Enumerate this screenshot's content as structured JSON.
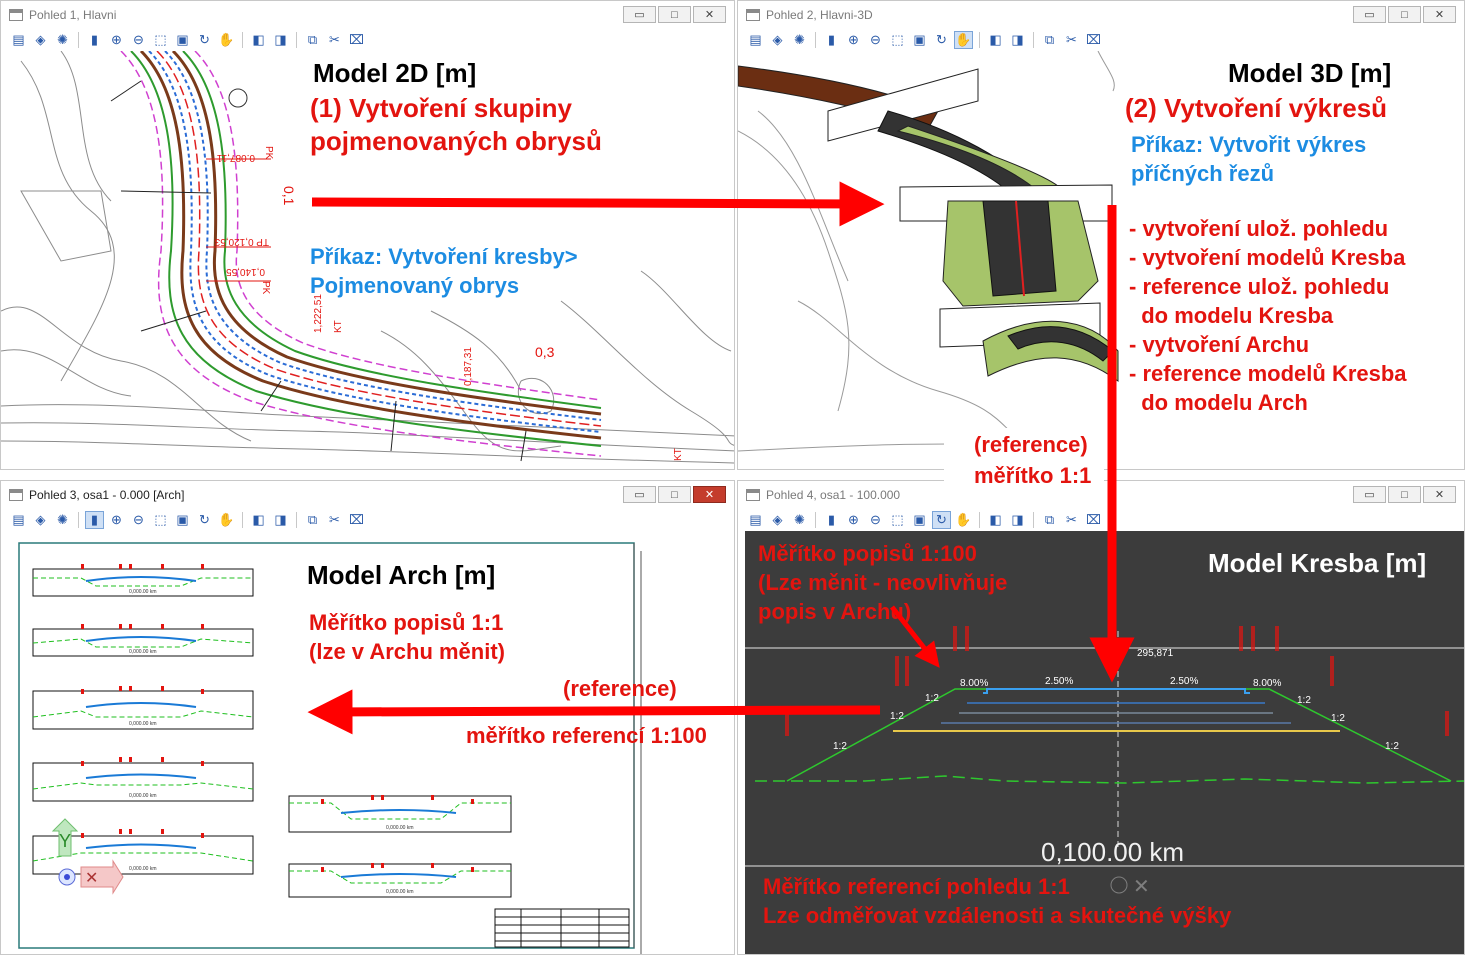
{
  "colors": {
    "annotation_red": "#ff0000",
    "command_blue": "#1c8ce2",
    "dark_view": "#3c3c3c"
  },
  "windows": {
    "w1": {
      "title": "Pohled 1, Hlavni"
    },
    "w2": {
      "title": "Pohled 2, Hlavni-3D"
    },
    "w3": {
      "title": "Pohled 3, osa1 - 0.000 [Arch]"
    },
    "w4": {
      "title": "Pohled 4, osa1 - 100.000"
    }
  },
  "window_buttons": {
    "minimize": "▭",
    "maximize": "□",
    "close": "✕"
  },
  "toolbar_icons": [
    "view-attributes-icon",
    "level-display-icon",
    "render-icon",
    "clear-icon",
    "zoom-in-icon",
    "zoom-out-icon",
    "window-area-icon",
    "fit-view-icon",
    "rotate-icon",
    "pan-icon",
    "view-previous-icon",
    "view-next-icon",
    "copy-view-icon",
    "clip-volume-icon",
    "clip-mask-icon"
  ],
  "drawing": {
    "w1_labels": [
      "0.087,11",
      "PK",
      "0,1",
      "TP 0,120,53",
      "0,140,55",
      "PK",
      "1,222,51",
      "KT",
      "0,3",
      "0,187,31",
      "KT"
    ],
    "w4_labels": {
      "station": "295,871",
      "slope_left": "8.00%",
      "slope_left2": "2.50%",
      "slope_right2": "2.50%",
      "slope_right": "8.00%",
      "ratio": "1:2",
      "km": "0,100.00 km"
    },
    "arch_km": "0,000.00 km"
  },
  "annotations": {
    "model2d": {
      "title": "Model 2D [m]",
      "step": "(1) Vytvoření skupiny",
      "step2": "pojmenovaných obrysů",
      "cmd1": "Příkaz: Vytvoření kresby>",
      "cmd2": "Pojmenovaný obrys"
    },
    "model3d": {
      "title": "Model 3D [m]",
      "step": "(2) Vytvoření výkresů",
      "cmd1": "Příkaz: Vytvořit výkres",
      "cmd2": "příčných řezů",
      "list": [
        "- vytvoření ulož. pohledu",
        "- vytvoření modelů Kresba",
        "- reference ulož. pohledu",
        "  do modelu Kresba",
        "- vytvoření Archu",
        "- reference modelů Kresba",
        "  do modelu Arch"
      ],
      "ref1": "(reference)",
      "ref2": "měřítko 1:1"
    },
    "arch": {
      "title": "Model Arch [m]",
      "scale1": "Měřítko popisů 1:1",
      "scale2": "(lze v Archu měnit)",
      "ref1": "(reference)",
      "ref2": "měřítko referencí 1:100"
    },
    "kresba": {
      "title": "Model Kresba [m]",
      "s1": "Měřítko popisů 1:100",
      "s2": "(Lze měnit - neovlivňuje",
      "s3": "popis v Archu)",
      "b1": "Měřítko referencí pohledu 1:1",
      "b2": "Lze odměřovat vzdálenosti a skutečné výšky"
    }
  }
}
